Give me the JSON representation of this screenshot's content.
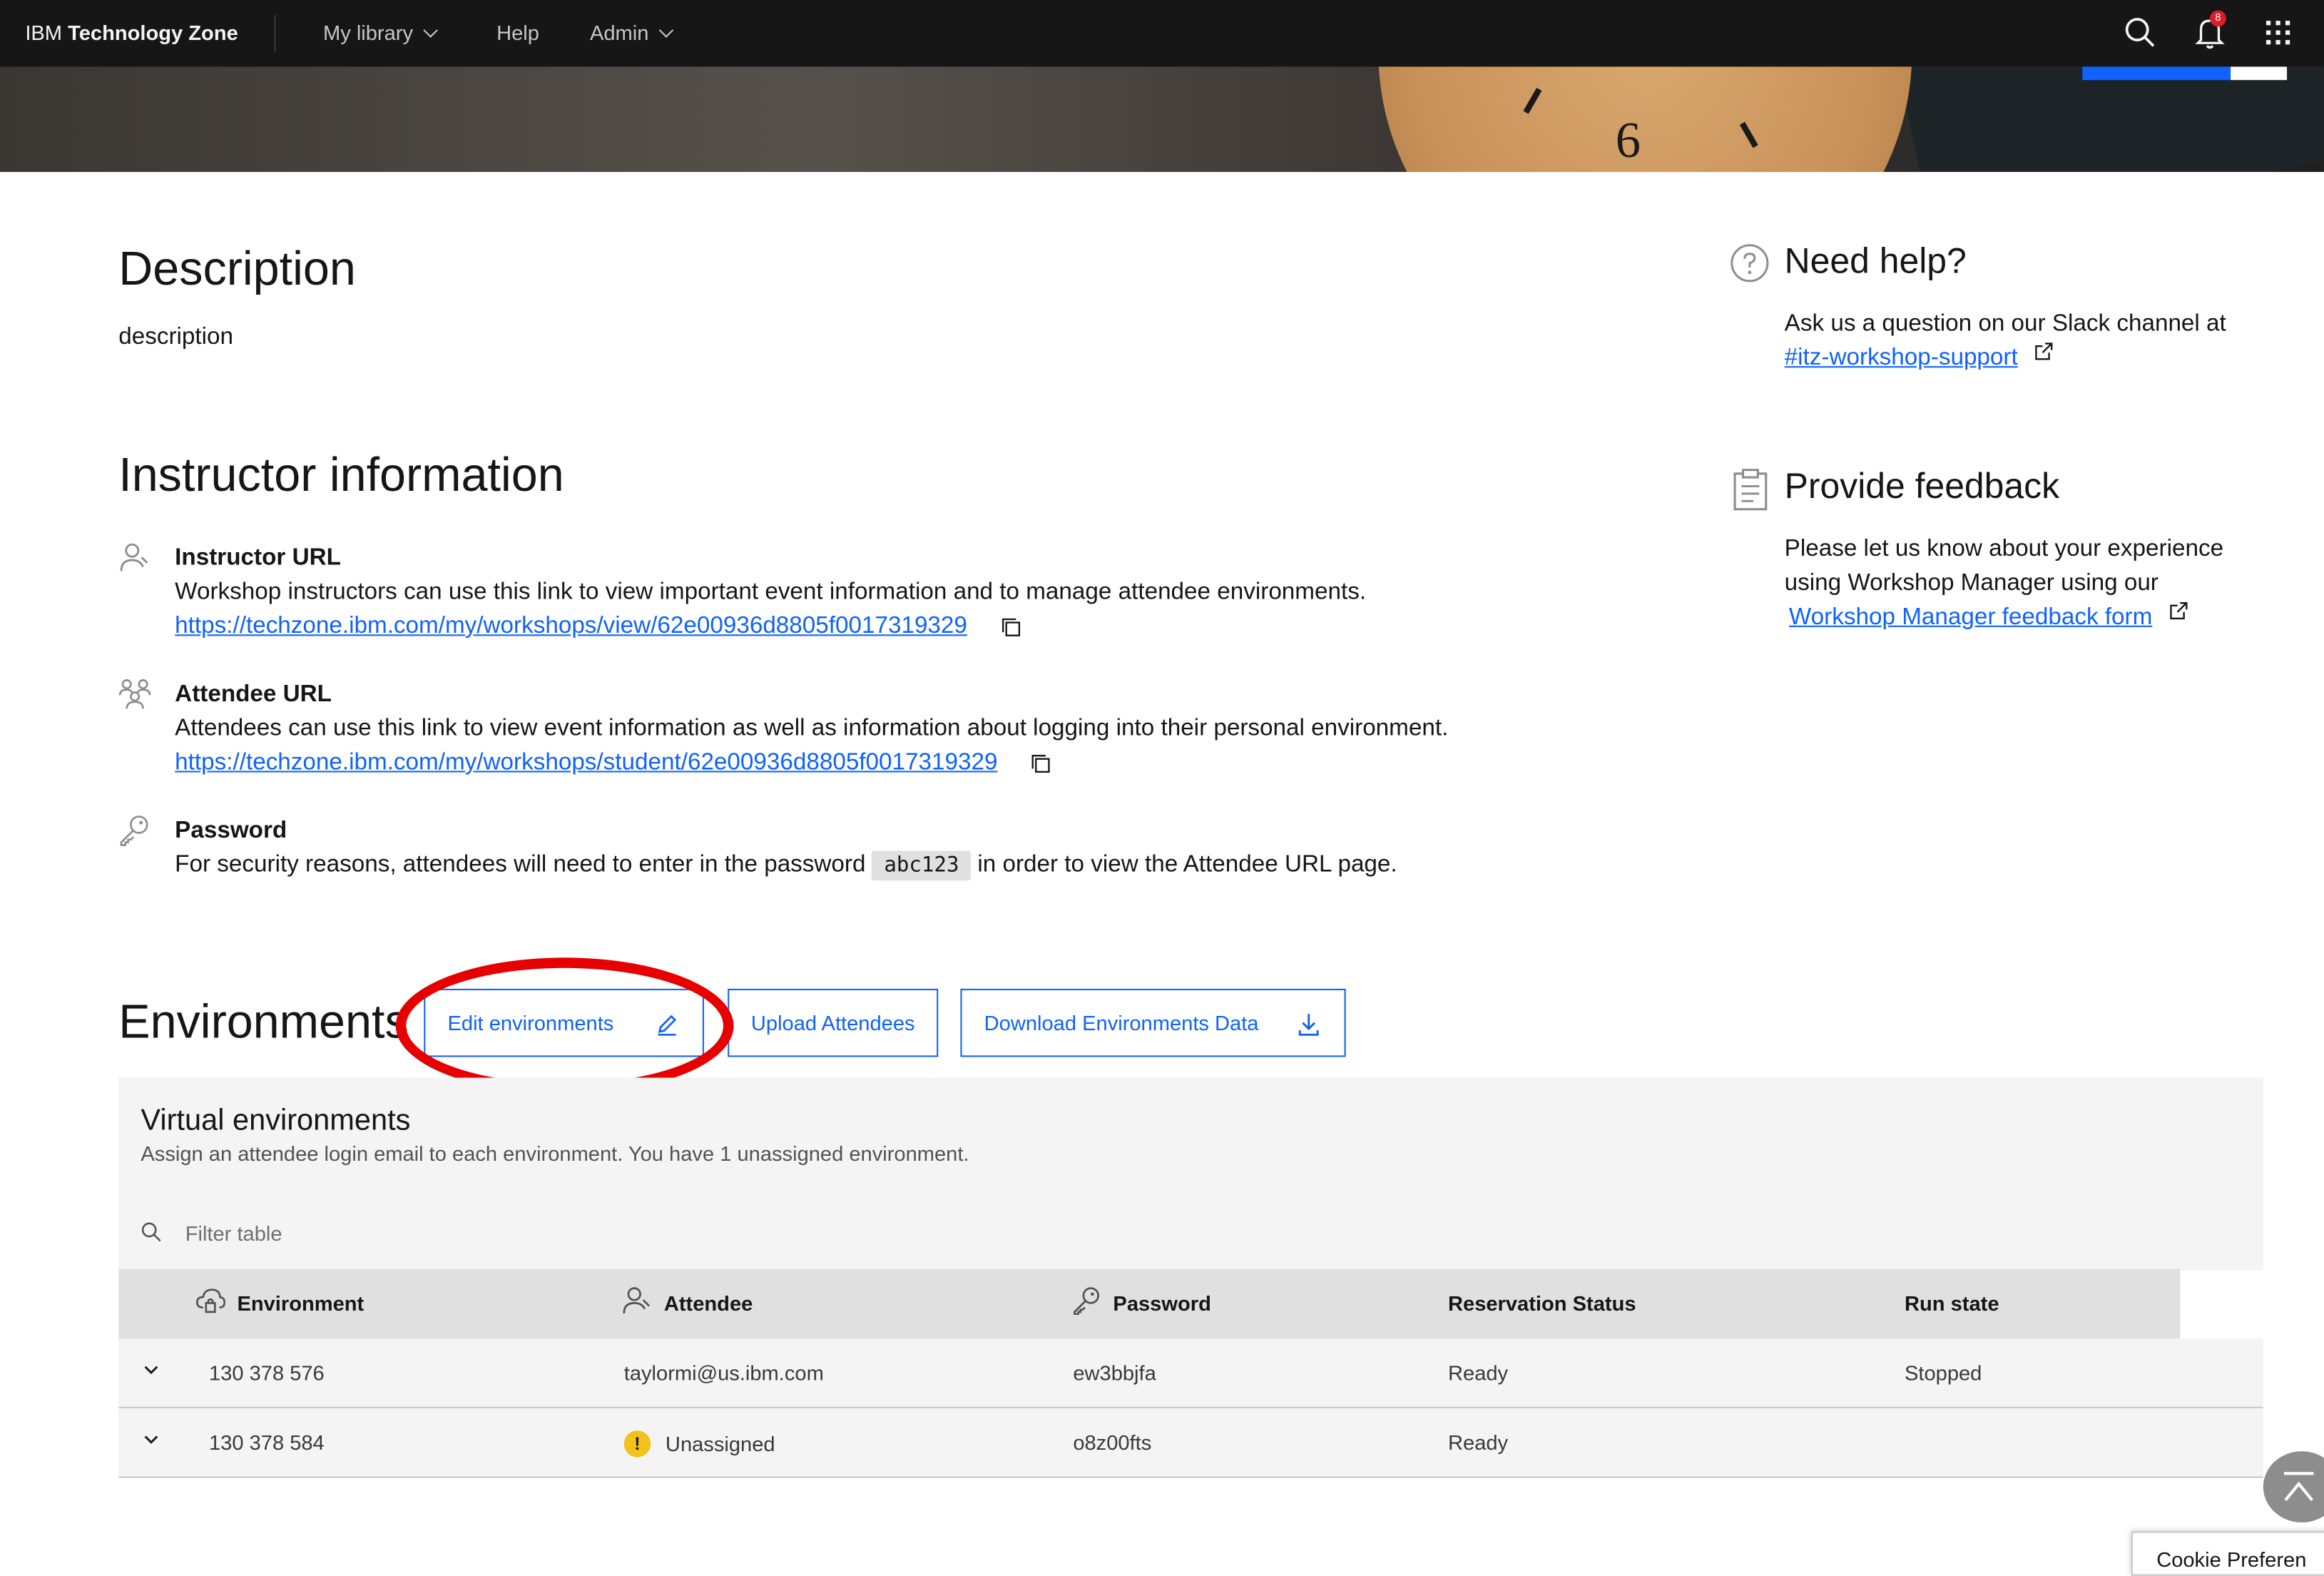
{
  "nav": {
    "brand_prefix": "IBM",
    "brand_name": "Technology Zone",
    "my_library": "My library",
    "help": "Help",
    "admin": "Admin",
    "notification_count": "8"
  },
  "description": {
    "heading": "Description",
    "text": "description"
  },
  "instructor": {
    "heading": "Instructor information",
    "instructor_url_label": "Instructor URL",
    "instructor_url_desc": "Workshop instructors can use this link to view important event information and to manage attendee environments.",
    "instructor_url": "https://techzone.ibm.com/my/workshops/view/62e00936d8805f0017319329",
    "attendee_url_label": "Attendee URL",
    "attendee_url_desc": "Attendees can use this link to view event information as well as information about logging into their personal environment.",
    "attendee_url": "https://techzone.ibm.com/my/workshops/student/62e00936d8805f0017319329",
    "password_label": "Password",
    "password_before": "For security reasons, attendees will need to enter in the password",
    "password_value": "abc123",
    "password_after": "in order to view the Attendee URL page."
  },
  "help": {
    "title": "Need help?",
    "text": "Ask us a question on our Slack channel at",
    "link": "#itz-workshop-support"
  },
  "feedback": {
    "title": "Provide feedback",
    "text_line1": "Please let us know about your experience",
    "text_line2": "using Workshop Manager using our",
    "link": "Workshop Manager feedback form"
  },
  "environments": {
    "heading": "Environments",
    "edit_button": "Edit environments",
    "upload_button": "Upload Attendees",
    "download_button": "Download Environments Data",
    "panel_title": "Virtual environments",
    "panel_subtitle": "Assign an attendee login email to each environment. You have 1 unassigned environment.",
    "filter_placeholder": "Filter table",
    "columns": [
      "Environment",
      "Attendee",
      "Password",
      "Reservation Status",
      "Run state"
    ],
    "rows": [
      {
        "environment": "130 378 576",
        "attendee": "taylormi@us.ibm.com",
        "password": "ew3bbjfa",
        "status": "Ready",
        "run_state": "Stopped"
      },
      {
        "environment": "130 378 584",
        "attendee": "Unassigned",
        "password": "o8z00fts",
        "status": "Ready",
        "run_state": ""
      }
    ]
  },
  "cookie": "Cookie Preferen",
  "colors": {
    "accent": "#0f62fe",
    "nav_bg": "#161616",
    "highlight": "#e60000",
    "warning": "#f1c21b"
  }
}
